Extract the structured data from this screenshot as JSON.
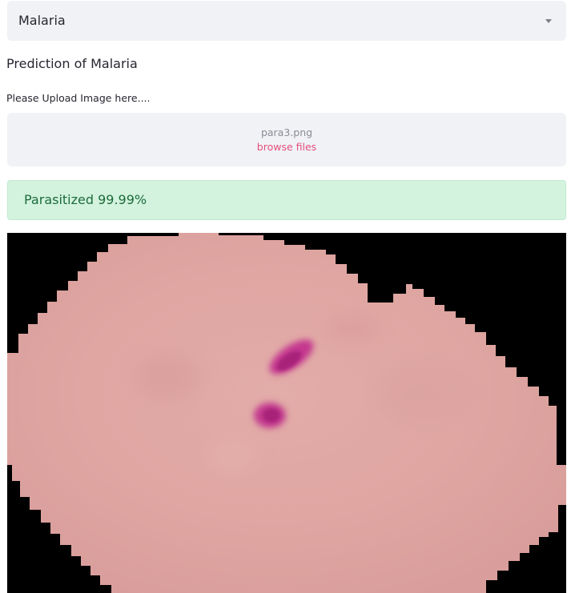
{
  "select": {
    "value": "Malaria"
  },
  "heading": "Prediction of Malaria",
  "uploader": {
    "label": "Please Upload Image here....",
    "file_name": "para3.png",
    "browse_label": "browse files"
  },
  "result": {
    "text": "Parasitized 99.99%"
  },
  "colors": {
    "success_bg": "#d3f3de",
    "success_text": "#1c6b3a",
    "link": "#e64f7c",
    "input_bg": "#f0f2f6"
  }
}
